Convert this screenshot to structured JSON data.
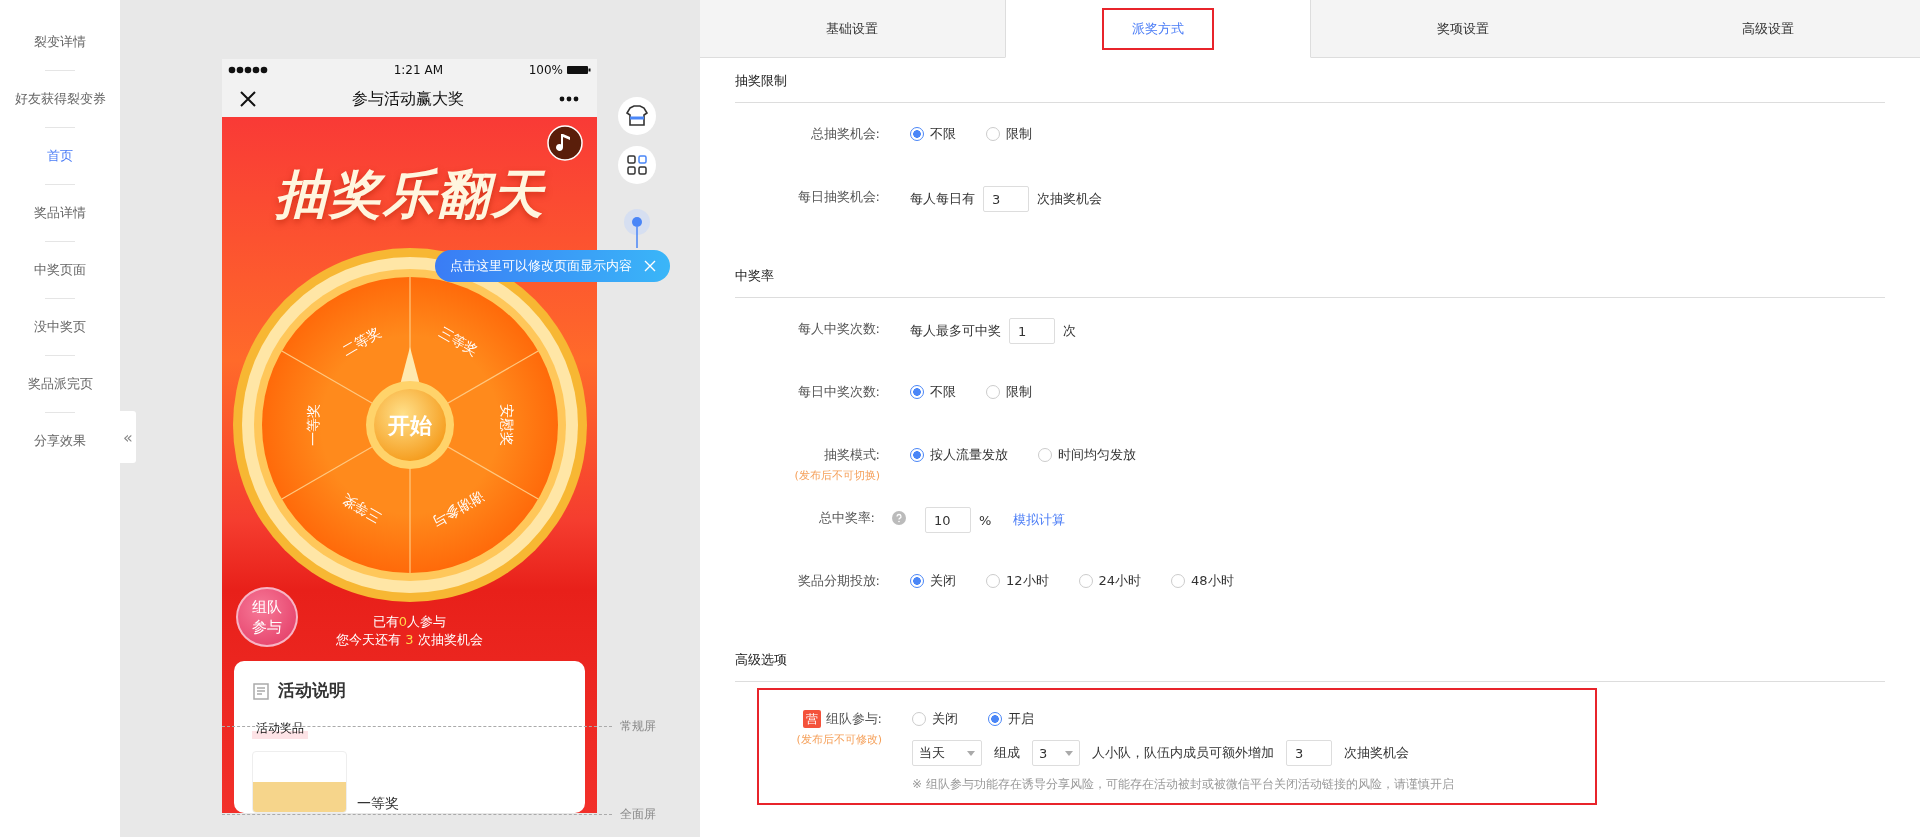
{
  "sidebar": {
    "items": [
      {
        "label": "裂变详情",
        "selected": false
      },
      {
        "label": "好友获得裂变券",
        "selected": false
      },
      {
        "label": "首页",
        "selected": true
      },
      {
        "label": "奖品详情",
        "selected": false
      },
      {
        "label": "中奖页面",
        "selected": false
      },
      {
        "label": "没中奖页",
        "selected": false
      },
      {
        "label": "奖品派完页",
        "selected": false
      },
      {
        "label": "分享效果",
        "selected": false
      }
    ],
    "collapse": "«"
  },
  "phone": {
    "status": {
      "time": "1:21 AM",
      "battery": "100%"
    },
    "nav_title": "参与活动赢大奖",
    "banner_title": "抽奖乐翻天",
    "wheel": {
      "segments": [
        "二等奖",
        "三等奖",
        "安慰奖",
        "谢谢参与",
        "三等奖",
        "一等奖"
      ],
      "start": "开始"
    },
    "team_badge": "组队参与",
    "stats": [
      {
        "before": "已有",
        "value": "0",
        "after": "人参与"
      },
      {
        "before": "您今天还有 ",
        "value": "3",
        "after": " 次抽奖机会"
      }
    ],
    "card": {
      "title": "活动说明",
      "tag": "活动奖品",
      "prize": "一等奖"
    }
  },
  "tooltip": "点击这里可以修改页面显示内容",
  "screen_markers": [
    "常规屏",
    "全面屏"
  ],
  "tabs": [
    {
      "label": "基础设置",
      "selected": false,
      "highlighted": false
    },
    {
      "label": "派奖方式",
      "selected": true,
      "highlighted": true
    },
    {
      "label": "奖项设置",
      "selected": false,
      "highlighted": false
    },
    {
      "label": "高级设置",
      "selected": false,
      "highlighted": false
    }
  ],
  "sections": [
    {
      "title": "抽奖限制",
      "highlighted": false,
      "rows": [
        {
          "kind": "radio",
          "label": "总抽奖机会:",
          "options": [
            {
              "label": "不限",
              "selected": true
            },
            {
              "label": "限制",
              "selected": false
            }
          ]
        },
        {
          "kind": "input",
          "label": "每日抽奖机会:",
          "before": "每人每日有",
          "value": "3",
          "after": "次抽奖机会"
        }
      ]
    },
    {
      "title": "中奖率",
      "highlighted": false,
      "rows": [
        {
          "kind": "input",
          "label": "每人中奖次数:",
          "before": "每人最多可中奖",
          "value": "1",
          "after": "次"
        },
        {
          "kind": "radio",
          "label": "每日中奖次数:",
          "options": [
            {
              "label": "不限",
              "selected": true
            },
            {
              "label": "限制",
              "selected": false
            }
          ]
        },
        {
          "kind": "radio",
          "label": "抽奖模式:",
          "note": "(发布后不可切换)",
          "options": [
            {
              "label": "按人流量发放",
              "selected": true
            },
            {
              "label": "时间均匀发放",
              "selected": false
            }
          ]
        },
        {
          "kind": "rate",
          "label": "总中奖率:",
          "value": "10",
          "after": "%",
          "link": "模拟计算"
        },
        {
          "kind": "radio",
          "label": "奖品分期投放:",
          "options": [
            {
              "label": "关闭",
              "selected": true
            },
            {
              "label": "12小时",
              "selected": false
            },
            {
              "label": "24小时",
              "selected": false
            },
            {
              "label": "48小时",
              "selected": false
            }
          ]
        }
      ]
    },
    {
      "title": "高级选项",
      "highlighted": true,
      "rows": [
        {
          "kind": "team",
          "badge": "营",
          "label": "组队参与:",
          "note": "(发布后不可修改)",
          "options": [
            {
              "label": "关闭",
              "selected": false
            },
            {
              "label": "开启",
              "selected": true
            }
          ],
          "period": "当天",
          "join": "组成",
          "size": "3",
          "team_text": "人小队，队伍内成员可额外增加",
          "extra": "3",
          "after": "次抽奖机会",
          "warning": "※ 组队参与功能存在诱导分享风险，可能存在活动被封或被微信平台关闭活动链接的风险，请谨慎开启"
        }
      ]
    }
  ]
}
